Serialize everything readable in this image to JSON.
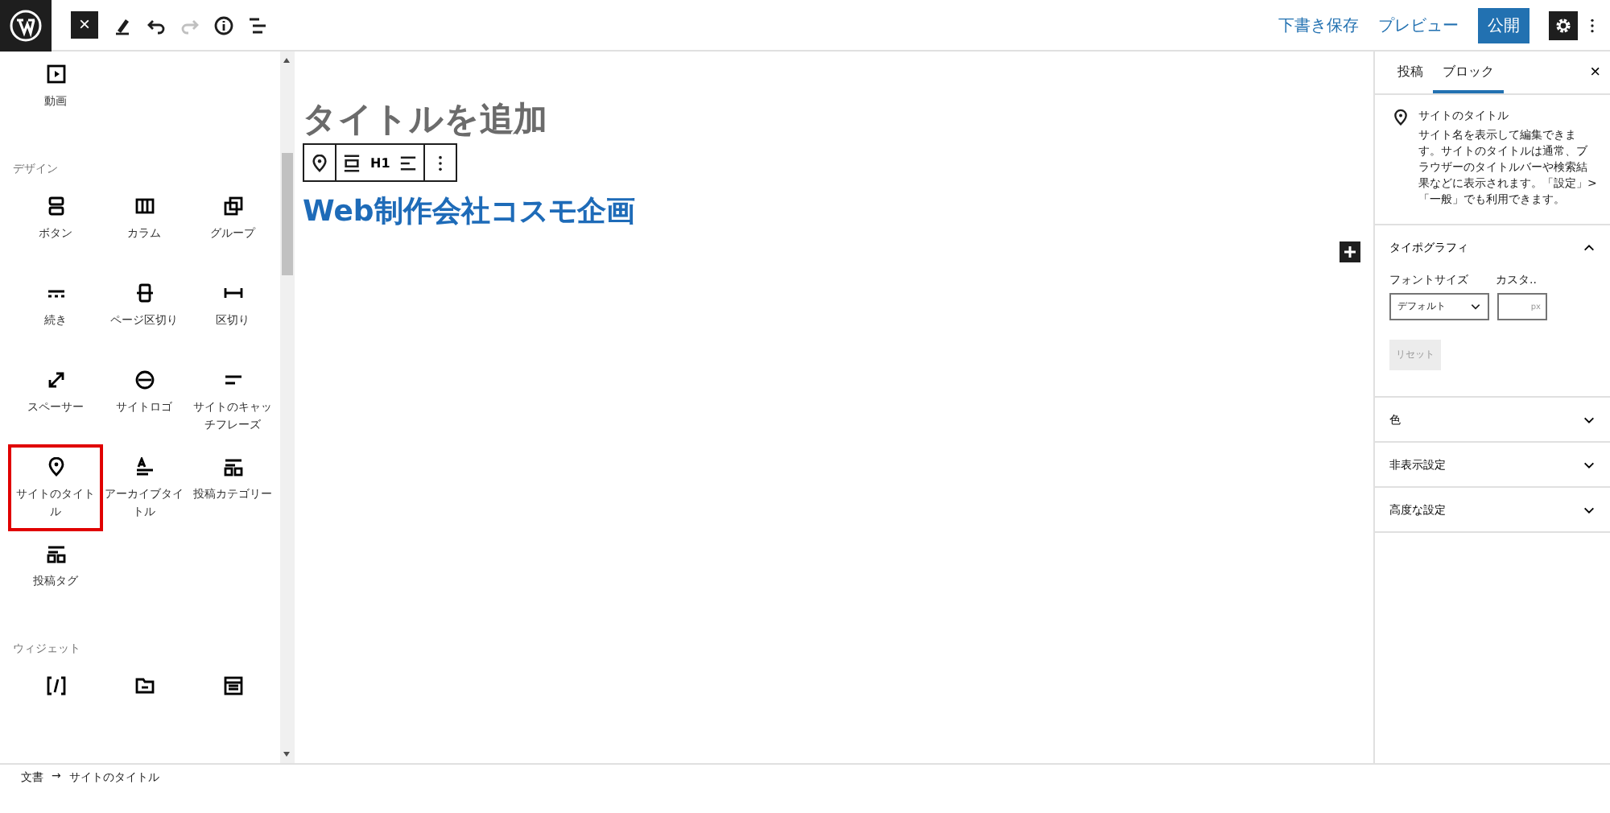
{
  "topbar": {
    "close": "×",
    "tools": [
      {
        "kind": "pen",
        "disabled": false
      },
      {
        "kind": "undo",
        "disabled": false
      },
      {
        "kind": "redo",
        "disabled": true
      },
      {
        "kind": "info",
        "disabled": false
      },
      {
        "kind": "list",
        "disabled": false
      }
    ],
    "save_draft": "下書き保存",
    "preview": "プレビュー",
    "publish": "公開",
    "settings_active": true
  },
  "inserter": {
    "sections": [
      {
        "blocks": [
          {
            "label": "動画",
            "kind": "video",
            "selected": false
          }
        ]
      },
      {
        "heading": "デザイン",
        "blocks": [
          {
            "label": "ボタン",
            "kind": "buttons",
            "selected": false
          },
          {
            "label": "カラム",
            "kind": "columns",
            "selected": false
          },
          {
            "label": "グループ",
            "kind": "group",
            "selected": false
          },
          {
            "label": "続き",
            "kind": "more",
            "selected": false
          },
          {
            "label": "ページ区切り",
            "kind": "pagebreak",
            "selected": false
          },
          {
            "label": "区切り",
            "kind": "separator",
            "selected": false
          },
          {
            "label": "スペーサー",
            "kind": "spacer",
            "selected": false
          },
          {
            "label": "サイトロゴ",
            "kind": "logo",
            "selected": false
          },
          {
            "label": "サイトのキャッチフレーズ",
            "kind": "tagline",
            "selected": false
          },
          {
            "label": "サイトのタイトル",
            "kind": "pin",
            "selected": true
          },
          {
            "label": "アーカイブタイトル",
            "kind": "archive",
            "selected": false
          },
          {
            "label": "投稿カテゴリー",
            "kind": "terms",
            "selected": false
          },
          {
            "label": "投稿タグ",
            "kind": "terms",
            "selected": false
          }
        ]
      },
      {
        "heading": "ウィジェット",
        "blocks": [
          {
            "kind": "shortcode",
            "selected": false
          },
          {
            "kind": "folder",
            "selected": false
          },
          {
            "kind": "calendar",
            "selected": false
          }
        ]
      }
    ]
  },
  "canvas": {
    "title_placeholder": "タイトルを追加",
    "block_toolbar": {
      "heading_level": "H1"
    },
    "site_title": "Web制作会社コスモ企画"
  },
  "sidebar": {
    "tabs": [
      {
        "label": "投稿",
        "selected": false
      },
      {
        "label": "ブロック",
        "selected": true
      }
    ],
    "close": "×",
    "block_card": {
      "title": "サイトのタイトル",
      "description": "サイト名を表示して編集できます。サイトのタイトルは通常、ブラウザーのタイトルバーや検索結果などに表示されます。「設定」>「一般」でも利用できます。"
    },
    "panels": [
      {
        "title": "タイポグラフィ",
        "expanded": true,
        "font_size_label": "フォントサイズ",
        "custom_label": "カスタ..",
        "select_value": "デフォルト",
        "unit": "px",
        "reset": "リセット",
        "reset_disabled": true
      },
      {
        "title": "色",
        "expanded": false
      },
      {
        "title": "非表示設定",
        "expanded": false
      },
      {
        "title": "高度な設定",
        "expanded": false
      }
    ]
  },
  "breadcrumb": {
    "items": [
      "文書",
      "サイトのタイトル"
    ],
    "separator": "→"
  }
}
